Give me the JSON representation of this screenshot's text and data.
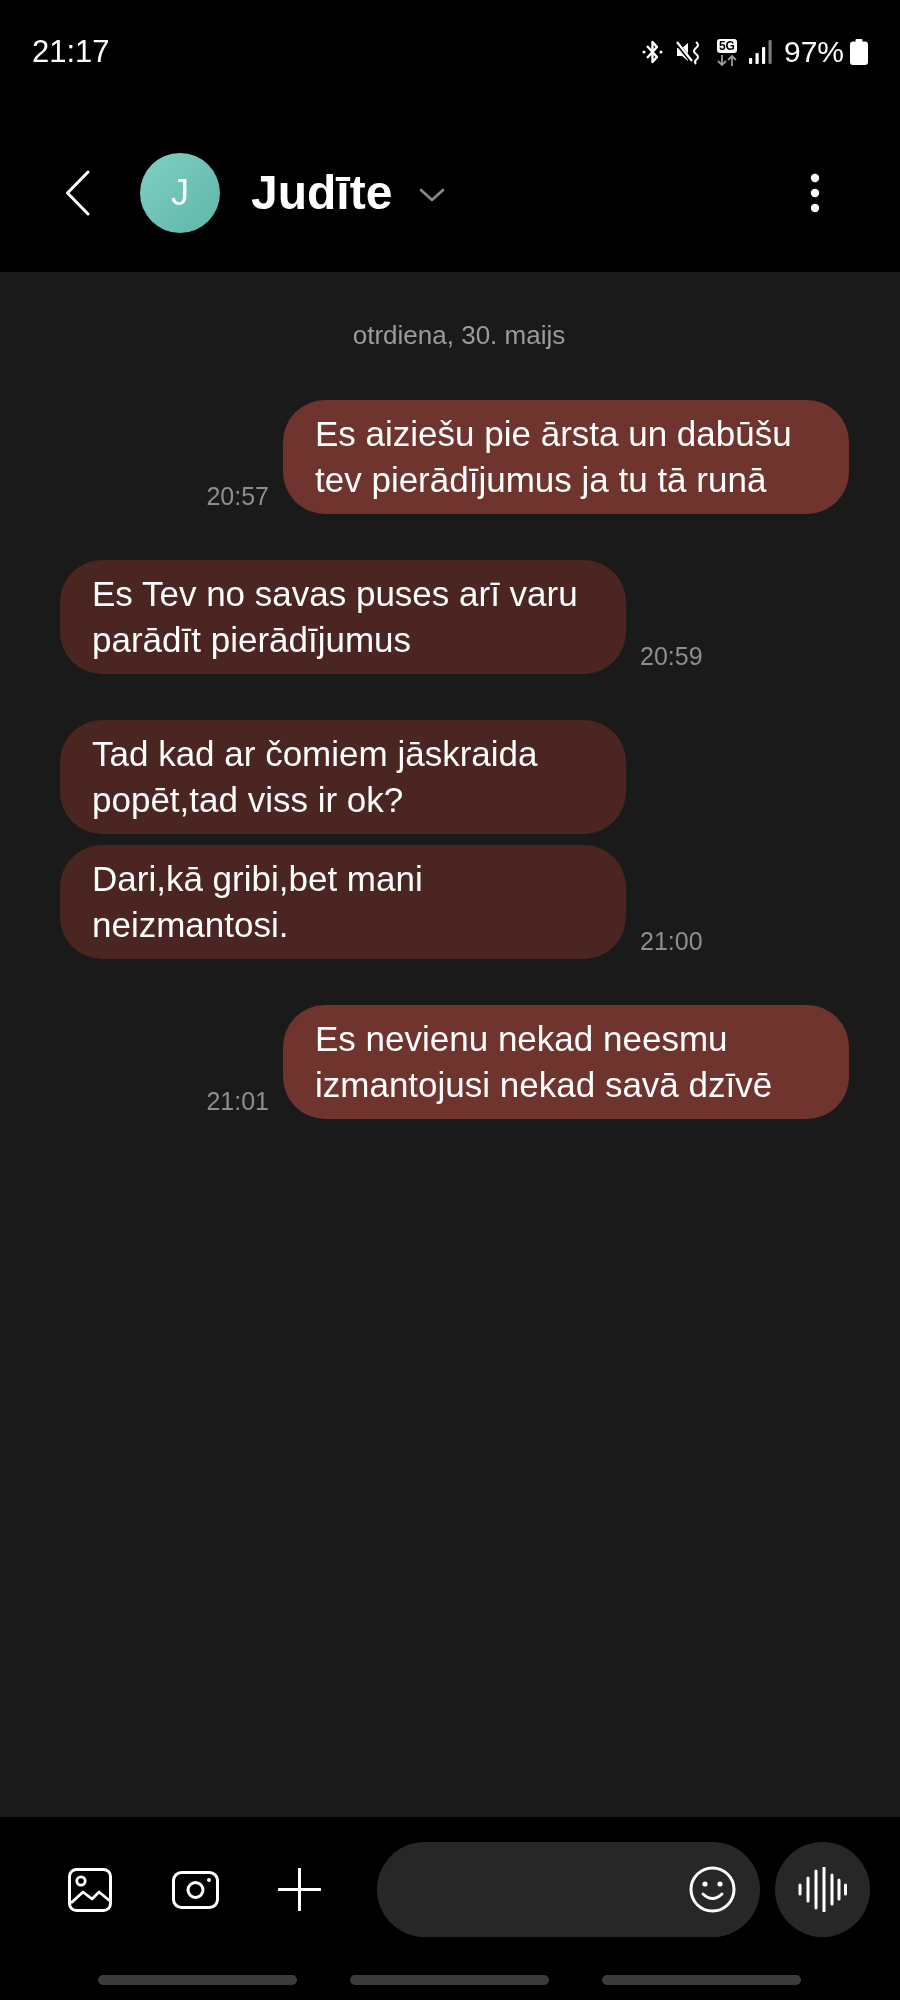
{
  "status_bar": {
    "time": "21:17",
    "network_type": "5G",
    "battery_percent": "97%"
  },
  "header": {
    "avatar_initial": "J",
    "contact_name": "Judīte"
  },
  "conversation": {
    "date_divider": "otrdiena, 30. maijs",
    "messages": [
      {
        "kind": "sent",
        "bubbles": [
          "Es aiziešu pie ārsta un dabūšu tev pierādījumus ja tu tā runā"
        ],
        "time": "20:57"
      },
      {
        "kind": "received",
        "bubbles": [
          "Es Tev no savas puses arī varu parādīt pierādījumus"
        ],
        "time": "20:59"
      },
      {
        "kind": "received",
        "bubbles": [
          "Tad kad ar čomiem jāskraida popēt,tad viss ir ok?",
          "Dari,kā gribi,bet mani neizmantosi."
        ],
        "time": "21:00"
      },
      {
        "kind": "sent",
        "bubbles": [
          "Es nevienu nekad neesmu izmantojusi nekad savā dzīvē"
        ],
        "time": "21:01"
      }
    ]
  }
}
